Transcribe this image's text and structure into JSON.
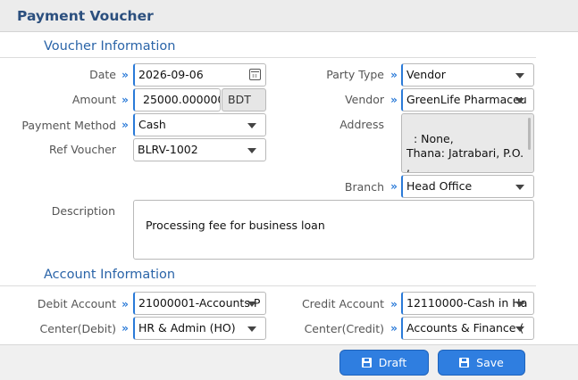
{
  "title": "Payment Voucher",
  "sections": {
    "voucher": "Voucher Information",
    "account": "Account Information"
  },
  "fields": {
    "date": {
      "label": "Date",
      "value": "2026-09-06"
    },
    "amount": {
      "label": "Amount",
      "value": "25000.000000",
      "currency": "BDT"
    },
    "payment_method": {
      "label": "Payment Method",
      "value": "Cash"
    },
    "ref_voucher": {
      "label": "Ref Voucher",
      "value": "BLRV-1002"
    },
    "party_type": {
      "label": "Party Type",
      "value": "Vendor"
    },
    "vendor": {
      "label": "Vendor",
      "value": "GreenLife Pharmaceu"
    },
    "address": {
      "label": "Address",
      "value": ": None,\nThana: Jatrabari, P.O.\n,\nDhaka-"
    },
    "branch": {
      "label": "Branch",
      "value": "Head Office"
    },
    "description": {
      "label": "Description",
      "value": "Processing fee for business loan"
    },
    "debit_account": {
      "label": "Debit Account",
      "value": "21000001-Accounts P"
    },
    "credit_account": {
      "label": "Credit Account",
      "value": "12110000-Cash in Ha"
    },
    "center_debit": {
      "label": "Center(Debit)",
      "value": "HR & Admin (HO)"
    },
    "center_credit": {
      "label": "Center(Credit)",
      "value": "Accounts & Finance ("
    }
  },
  "buttons": {
    "draft": "Draft",
    "save": "Save"
  },
  "colors": {
    "accent": "#2a7ad8",
    "title": "#2b4f7e",
    "section": "#2a64a8",
    "button": "#2f7ee0"
  },
  "icons": {
    "required_marker": "double-chevron-right-icon",
    "date_picker": "calendar-icon",
    "dropdown": "caret-down-icon",
    "button": "floppy-disk-icon"
  }
}
